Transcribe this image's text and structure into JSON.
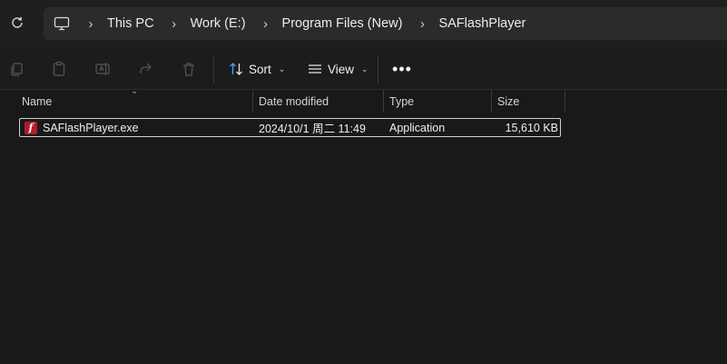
{
  "address_bar": {
    "refresh_icon": "refresh-icon",
    "pc_icon": "monitor-icon",
    "breadcrumbs": [
      "This PC",
      "Work (E:)",
      "Program Files (New)",
      "SAFlashPlayer"
    ]
  },
  "toolbar": {
    "sort_label": "Sort",
    "view_label": "View",
    "more_label": "•••"
  },
  "columns": {
    "name": "Name",
    "date": "Date modified",
    "type": "Type",
    "size": "Size"
  },
  "files": [
    {
      "name": "SAFlashPlayer.exe",
      "date": "2024/10/1 周二 11:49",
      "type": "Application",
      "size": "15,610 KB",
      "icon": "flash-icon",
      "icon_color": "#b01e23"
    }
  ],
  "colors": {
    "background": "#191919",
    "addressbar": "#2b2b2b",
    "accent_icon": "#4aa3ff"
  }
}
